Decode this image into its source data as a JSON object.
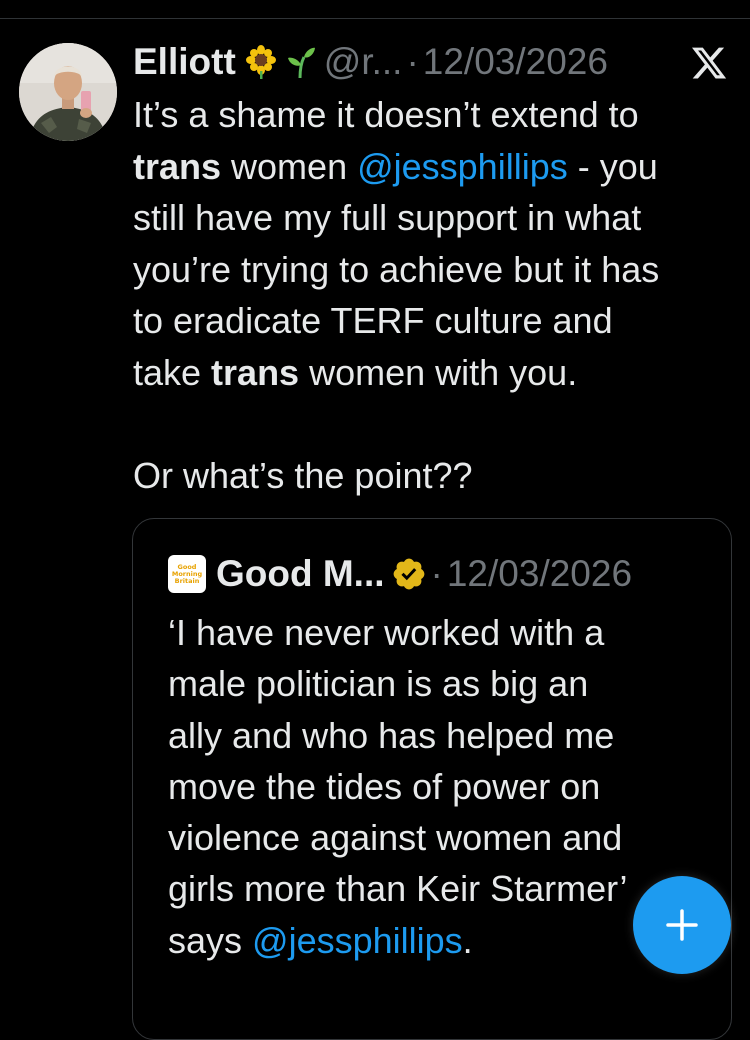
{
  "tweet": {
    "author_name": "Elliott",
    "handle": "@r...",
    "date": "12/03/2026",
    "separator": "·",
    "lines": [
      [
        {
          "t": "It’s a shame it doesn’t extend to"
        }
      ],
      [
        {
          "t": "trans",
          "b": true
        },
        {
          "t": " women "
        },
        {
          "t": "@jessphillips",
          "m": true
        },
        {
          "t": " - you"
        }
      ],
      [
        {
          "t": "still have my full support in what"
        }
      ],
      [
        {
          "t": "you’re trying to achieve but it has"
        }
      ],
      [
        {
          "t": "to eradicate TERF culture and"
        }
      ],
      [
        {
          "t": "take "
        },
        {
          "t": "trans",
          "b": true
        },
        {
          "t": " women with you."
        }
      ],
      [],
      [
        {
          "t": "Or what’s the point??"
        }
      ]
    ]
  },
  "quoted_tweet": {
    "author_name": "Good M...",
    "date": "12/03/2026",
    "separator": "·",
    "logo_lines": [
      "Good",
      "Morning",
      "Britain"
    ],
    "lines": [
      [
        {
          "t": "‘I have never worked with a"
        }
      ],
      [
        {
          "t": "male politician is as big an"
        }
      ],
      [
        {
          "t": "ally and who has helped me"
        }
      ],
      [
        {
          "t": "move the tides of power on"
        }
      ],
      [
        {
          "t": "violence against women and"
        }
      ],
      [
        {
          "t": "girls more than Keir Starmer’"
        }
      ],
      [
        {
          "t": "says "
        },
        {
          "t": "@jessphillips",
          "m": true
        },
        {
          "t": "."
        }
      ]
    ]
  },
  "icons": {
    "emoji_1": "sunflower-icon",
    "emoji_2": "seedling-icon",
    "platform": "x-logo-icon",
    "verified": "verified-badge-icon",
    "compose": "plus-icon"
  },
  "colors": {
    "background": "#000000",
    "text": "#e7e9ea",
    "muted": "#71767b",
    "accent": "#1d9bf0",
    "verified_gold": "#e2b719"
  }
}
